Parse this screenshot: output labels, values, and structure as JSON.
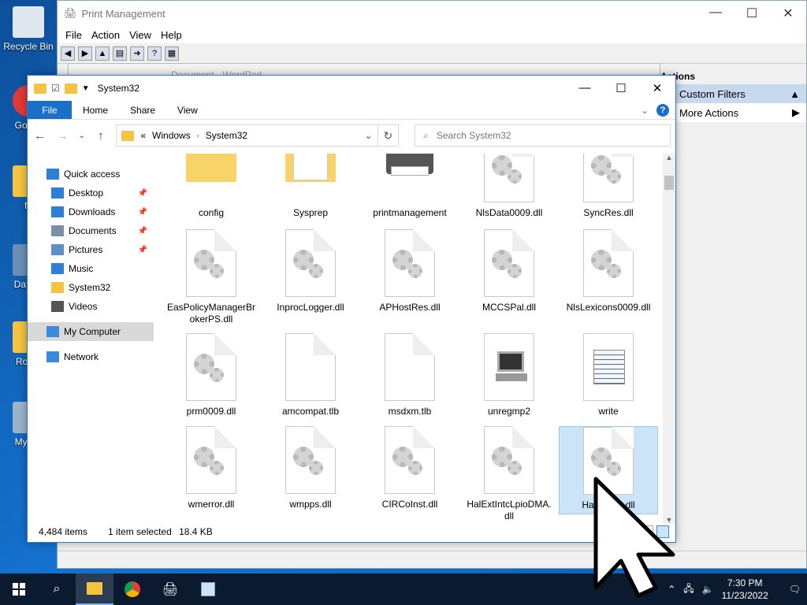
{
  "desktop": {
    "icons": [
      {
        "label": "Recycle Bin"
      },
      {
        "label": "Go Ch"
      },
      {
        "label": "fo"
      },
      {
        "label": "DataW"
      },
      {
        "label": "Romh"
      },
      {
        "label": "My Co"
      }
    ]
  },
  "print_management": {
    "title": "Print Management",
    "menu": [
      "File",
      "Action",
      "View",
      "Help"
    ],
    "actions": {
      "header": "Actions",
      "selected": "Custom Filters",
      "more": "More Actions"
    }
  },
  "wordpad": {
    "title": "Document - WordPad"
  },
  "explorer": {
    "title": "System32",
    "ribbon": {
      "file": "File",
      "tabs": [
        "Home",
        "Share",
        "View"
      ]
    },
    "address": {
      "prefix": "«",
      "path": [
        "Windows",
        "System32"
      ]
    },
    "search_placeholder": "Search System32",
    "sidebar": [
      {
        "label": "Quick access",
        "pinned": false,
        "icon": "star-icon",
        "color": "#2e7fd6"
      },
      {
        "label": "Desktop",
        "pinned": true,
        "icon": "desktop-icon",
        "color": "#2e7fd6"
      },
      {
        "label": "Downloads",
        "pinned": true,
        "icon": "download-icon",
        "color": "#2e7fd6"
      },
      {
        "label": "Documents",
        "pinned": true,
        "icon": "documents-icon",
        "color": "#7a8fa8"
      },
      {
        "label": "Pictures",
        "pinned": true,
        "icon": "pictures-icon",
        "color": "#5b8fc7"
      },
      {
        "label": "Music",
        "pinned": false,
        "icon": "music-icon",
        "color": "#2e7fd6"
      },
      {
        "label": "System32",
        "pinned": false,
        "icon": "folder-icon",
        "color": "#f4c441"
      },
      {
        "label": "Videos",
        "pinned": false,
        "icon": "videos-icon",
        "color": "#555555"
      },
      {
        "label": "My Computer",
        "pinned": false,
        "icon": "computer-icon",
        "color": "#3d8ad8",
        "selected": true
      },
      {
        "label": "Network",
        "pinned": false,
        "icon": "network-icon",
        "color": "#3d8ad8"
      }
    ],
    "files": [
      {
        "name": "config",
        "type": "folder"
      },
      {
        "name": "Sysprep",
        "type": "folder-doc"
      },
      {
        "name": "printmanagement",
        "type": "printer"
      },
      {
        "name": "NlsData0009.dll",
        "type": "dll"
      },
      {
        "name": "SyncRes.dll",
        "type": "dll"
      },
      {
        "name": "EasPolicyManagerBrokerPS.dll",
        "type": "dll"
      },
      {
        "name": "InprocLogger.dll",
        "type": "dll"
      },
      {
        "name": "APHostRes.dll",
        "type": "dll"
      },
      {
        "name": "MCCSPal.dll",
        "type": "dll"
      },
      {
        "name": "NlsLexicons0009.dll",
        "type": "dll"
      },
      {
        "name": "prm0009.dll",
        "type": "dll"
      },
      {
        "name": "amcompat.tlb",
        "type": "blank"
      },
      {
        "name": "msdxm.tlb",
        "type": "blank"
      },
      {
        "name": "unregmp2",
        "type": "app-computer"
      },
      {
        "name": "write",
        "type": "app-notepad"
      },
      {
        "name": "wmerror.dll",
        "type": "dll"
      },
      {
        "name": "wmpps.dll",
        "type": "dll"
      },
      {
        "name": "CIRCoInst.dll",
        "type": "dll"
      },
      {
        "name": "HalExtIntcLpioDMA.dll",
        "type": "dll"
      },
      {
        "name": "HalExt...0.dll",
        "type": "dll",
        "selected": true
      }
    ],
    "status": {
      "items": "4,484 items",
      "selected": "1 item selected",
      "size": "18.4 KB"
    }
  },
  "taskbar": {
    "time": "7:30 PM",
    "date": "11/23/2022"
  }
}
